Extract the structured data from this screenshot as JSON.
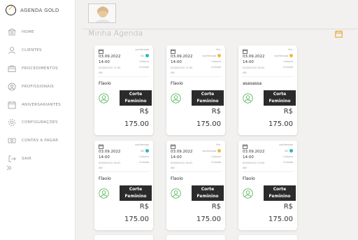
{
  "app": {
    "name": "AGENDA GOLD"
  },
  "sidebar": {
    "items": [
      {
        "label": "HOME",
        "icon": "bank-icon"
      },
      {
        "label": "CLIENTES",
        "icon": "user-icon"
      },
      {
        "label": "PROCEDIMENTOS",
        "icon": "briefcase-icon"
      },
      {
        "label": "PROFISSIONAIS",
        "icon": "user-circle-icon"
      },
      {
        "label": "ANIVERSARIANTES",
        "icon": "calendar-icon"
      },
      {
        "label": "CONFIGURAÇÕES",
        "icon": "gear-icon"
      },
      {
        "label": "CONTAS A PAGAR",
        "icon": "money-icon"
      },
      {
        "label": "SAIR",
        "icon": "logout-icon"
      }
    ]
  },
  "header": {
    "title": "Minha Agenda"
  },
  "colors": {
    "confirmed_dot": "#2bb5c7",
    "pending_dot": "#f4b73e",
    "service_bg": "#2b2b2b",
    "avatar_green": "#5cb85c"
  },
  "cards": [
    {
      "status": "confirmado",
      "date": "03.09.2022",
      "time": "14:00",
      "created": "02/09/2022 17:49",
      "creator": "AW",
      "status_short": "SD",
      "dot": "confirmed",
      "confirm_label": "Compro",
      "initiated": "Iniciado",
      "client": "Flavio",
      "service": "Corte Feminino",
      "currency": "R$",
      "price": "175.00"
    },
    {
      "status": "Pre.",
      "date": "03.09.2022",
      "time": "14:00",
      "created": "02/09/2022 17:49",
      "creator": "AW",
      "status_short": "confirmado",
      "dot": "pending",
      "confirm_label": "Compro",
      "initiated": "Iniciado",
      "client": "Flavio",
      "service": "Corte Feminino",
      "currency": "R$",
      "price": "175.00"
    },
    {
      "status": "Pre.",
      "date": "03.09.2022",
      "time": "14:00",
      "created": "02/09/2022 18:02",
      "creator": "AW",
      "status_short": "confirmado",
      "dot": "pending",
      "confirm_label": "Compro",
      "initiated": "Iniciado",
      "client": "asasassa",
      "service": "Corte Feminino",
      "currency": "R$",
      "price": "175.00"
    },
    {
      "status": "confirmado",
      "date": "03.09.2022",
      "time": "14:00",
      "created": "02/09/2022 18:42",
      "creator": "AW",
      "status_short": "SD",
      "dot": "confirmed",
      "confirm_label": "Compro",
      "initiated": "Iniciado",
      "client": "Flavio",
      "service": "Corte Feminino",
      "currency": "R$",
      "price": "175.00"
    },
    {
      "status": "Pre.",
      "date": "03.09.2022",
      "time": "14:00",
      "created": "02/09/2022 18:42",
      "creator": "AW",
      "status_short": "confirmado",
      "dot": "pending",
      "confirm_label": "Compro",
      "initiated": "Iniciado",
      "client": "Flavio",
      "service": "Corte Feminino",
      "currency": "R$",
      "price": "175.00"
    },
    {
      "status": "confirmado",
      "date": "03.09.2022",
      "time": "14:00",
      "created": "02/09/2022 19:00",
      "creator": "AW",
      "status_short": "SD",
      "dot": "confirmed",
      "confirm_label": "Compro",
      "initiated": "Iniciado",
      "client": "Flavio",
      "service": "Corte Feminino",
      "currency": "R$",
      "price": "175.00"
    }
  ]
}
